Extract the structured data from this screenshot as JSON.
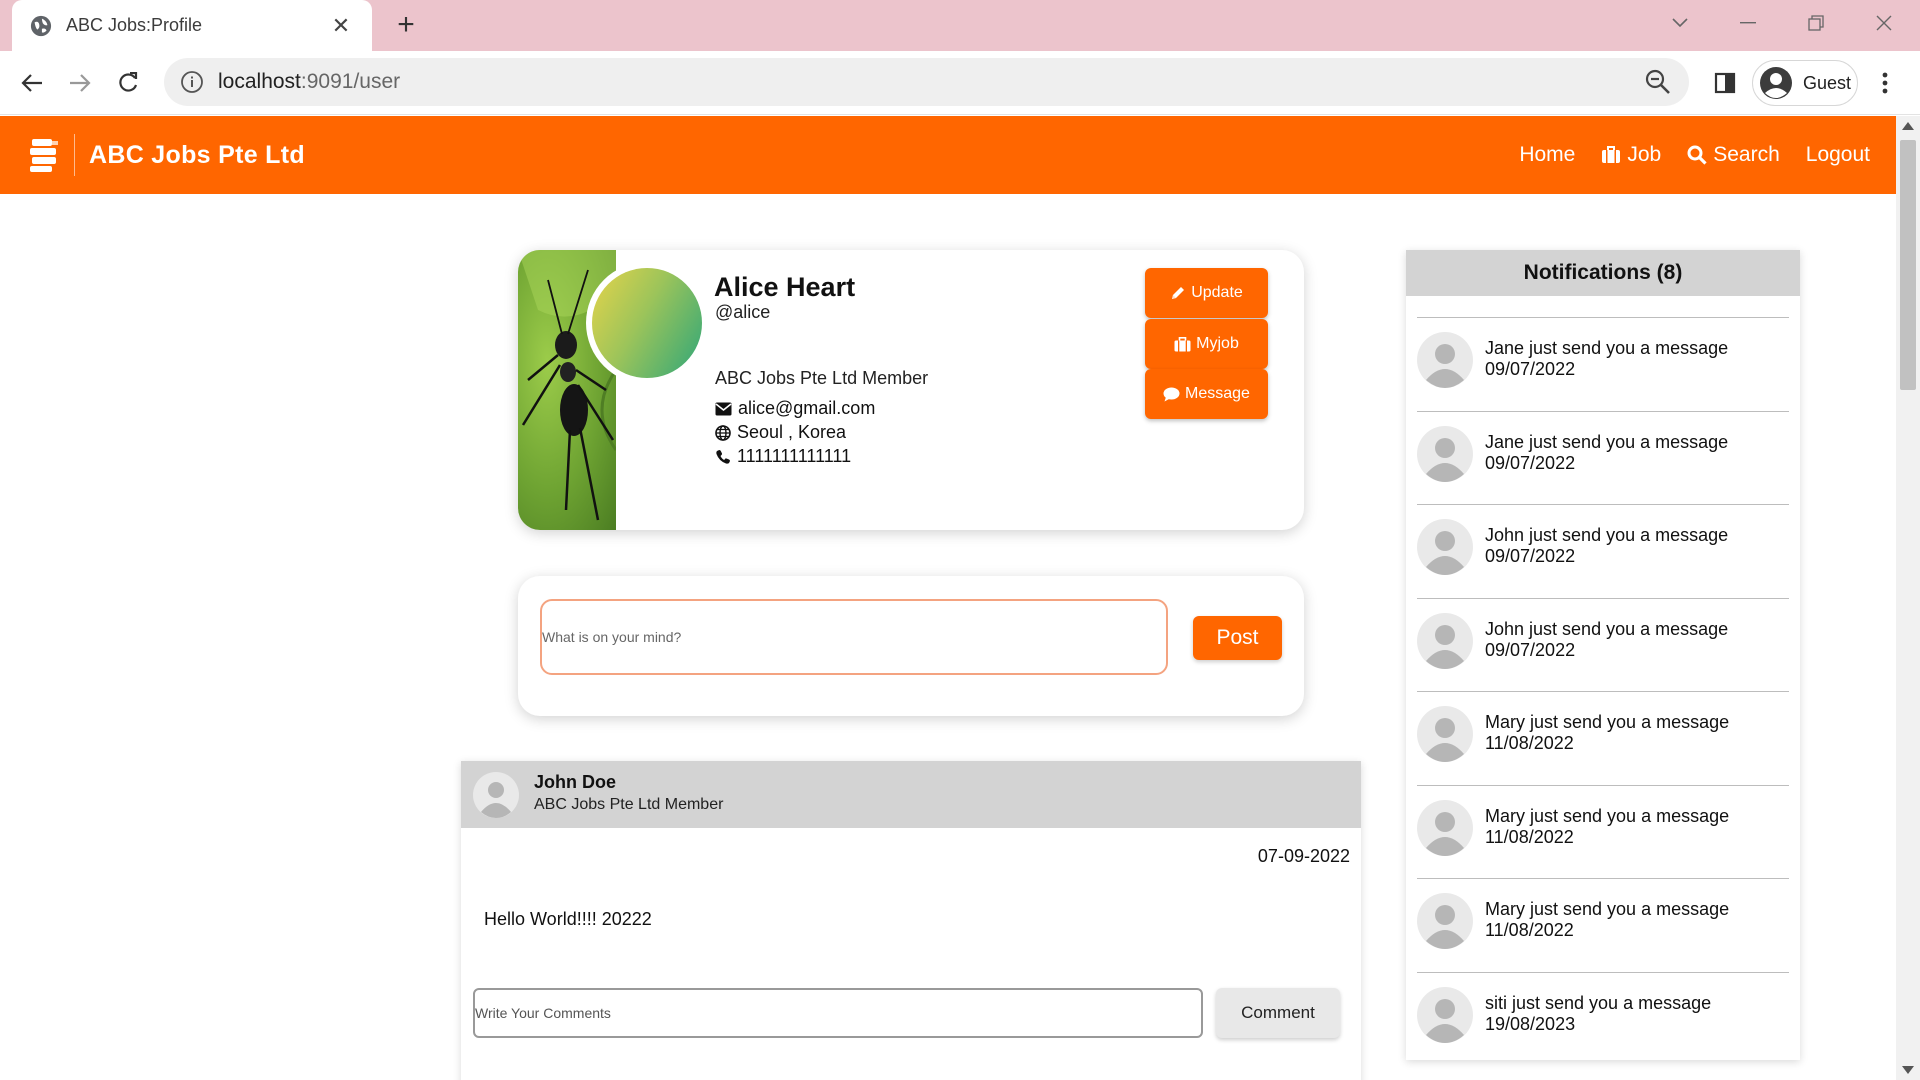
{
  "browser": {
    "tab_title": "ABC Jobs:Profile",
    "url_host": "localhost",
    "url_path": ":9091/user",
    "profile_label": "Guest"
  },
  "navbar": {
    "brand": "ABC Jobs Pte Ltd",
    "links": [
      "Home",
      "Job",
      "Search",
      "Logout"
    ],
    "accent_color": "#ff6600"
  },
  "profile": {
    "name": "Alice Heart",
    "handle": "@alice",
    "member": "ABC Jobs Pte Ltd Member",
    "email": "alice@gmail.com",
    "location": "Seoul , Korea",
    "phone": "1111111111111",
    "buttons": {
      "update": "Update",
      "myjob": "Myjob",
      "message": "Message"
    }
  },
  "composer": {
    "placeholder": "What is on your mind?",
    "post_label": "Post"
  },
  "post": {
    "author": "John Doe",
    "author_role": "ABC Jobs Pte Ltd Member",
    "date": "07-09-2022",
    "body": "Hello World!!!! 20222",
    "comment_placeholder": "Write Your Comments",
    "comment_label": "Comment"
  },
  "notifications": {
    "title": "Notifications (8)",
    "items": [
      {
        "text": "Jane just send you a message",
        "date": "09/07/2022"
      },
      {
        "text": "Jane just send you a message",
        "date": "09/07/2022"
      },
      {
        "text": "John just send you a message",
        "date": "09/07/2022"
      },
      {
        "text": "John just send you a message",
        "date": "09/07/2022"
      },
      {
        "text": "Mary just send you a message",
        "date": "11/08/2022"
      },
      {
        "text": "Mary just send you a message",
        "date": "11/08/2022"
      },
      {
        "text": "Mary just send you a message",
        "date": "11/08/2022"
      },
      {
        "text": "siti just send you a message",
        "date": "19/08/2023"
      }
    ]
  }
}
